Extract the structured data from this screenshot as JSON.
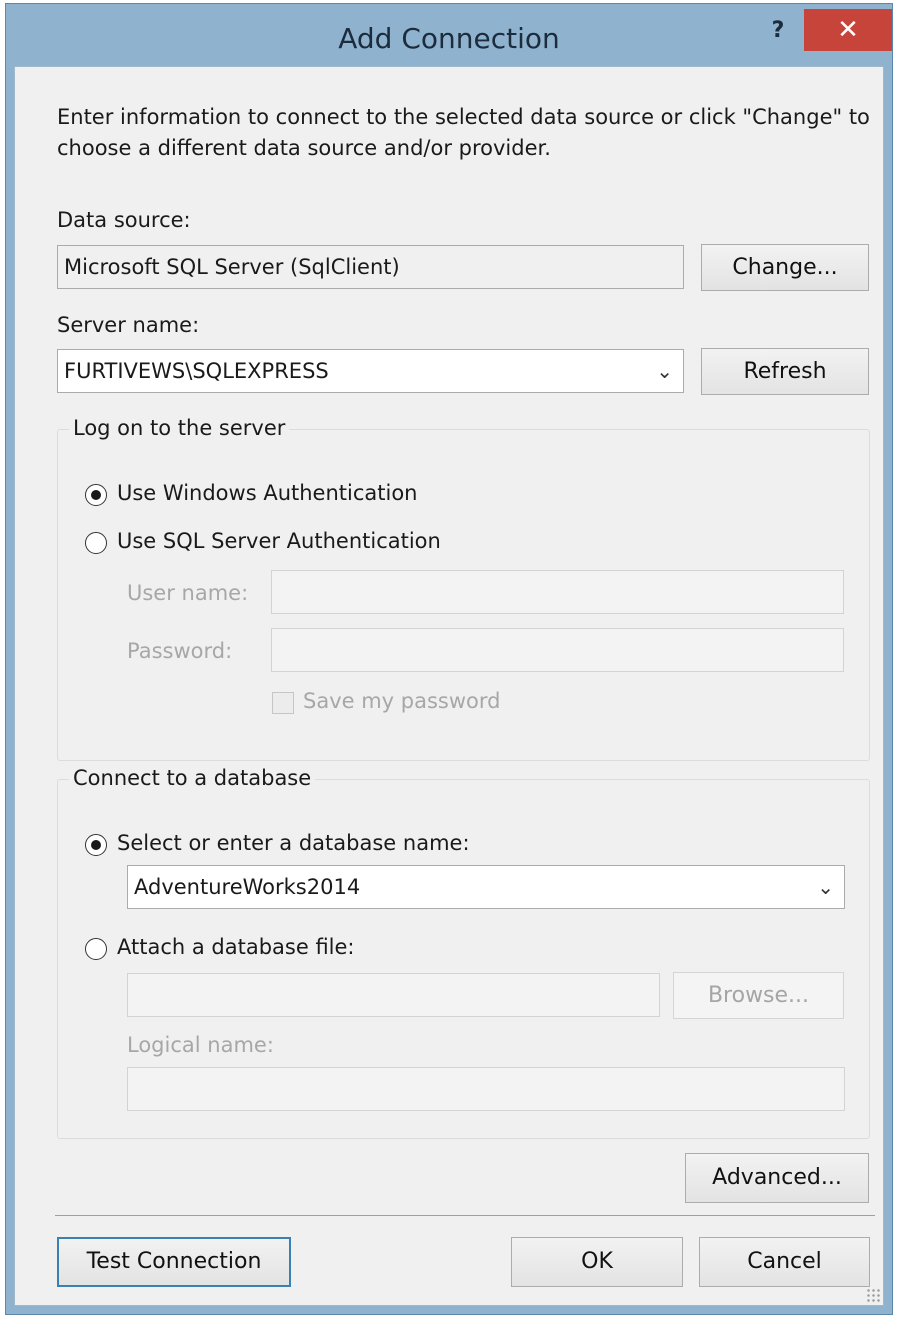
{
  "dialog": {
    "title": "Add Connection",
    "help_glyph": "?",
    "close_glyph": "✕",
    "intro": "Enter information to connect to the selected data source or click \"Change\" to choose a different data source and/or provider."
  },
  "data_source": {
    "label": "Data source:",
    "value": "Microsoft SQL Server (SqlClient)",
    "change_button": "Change..."
  },
  "server": {
    "label": "Server name:",
    "value": "FURTIVEWS\\SQLEXPRESS",
    "refresh_button": "Refresh"
  },
  "logon": {
    "group_title": "Log on to the server",
    "windows_auth": {
      "label": "Use Windows Authentication",
      "checked": true
    },
    "sql_auth": {
      "label": "Use SQL Server Authentication",
      "checked": false
    },
    "user_name_label": "User name:",
    "user_name_value": "",
    "password_label": "Password:",
    "password_value": "",
    "save_password": {
      "label": "Save my password",
      "checked": false,
      "enabled": false
    }
  },
  "database": {
    "group_title": "Connect to a database",
    "select_option": {
      "label": "Select or enter a database name:",
      "checked": true
    },
    "database_name": "AdventureWorks2014",
    "attach_option": {
      "label": "Attach a database file:",
      "checked": false
    },
    "attach_file_value": "",
    "browse_button": "Browse...",
    "logical_name_label": "Logical name:",
    "logical_name_value": ""
  },
  "buttons": {
    "advanced": "Advanced...",
    "test_connection": "Test Connection",
    "ok": "OK",
    "cancel": "Cancel"
  },
  "icons": {
    "dropdown_arrow": "chevron-down-icon",
    "help": "help-icon",
    "close": "close-icon"
  },
  "colors": {
    "titlebar": "#8fb3cf",
    "close_button": "#c7443a",
    "default_button_border": "#3c7fb1",
    "dialog_background": "#f0f0f0"
  }
}
